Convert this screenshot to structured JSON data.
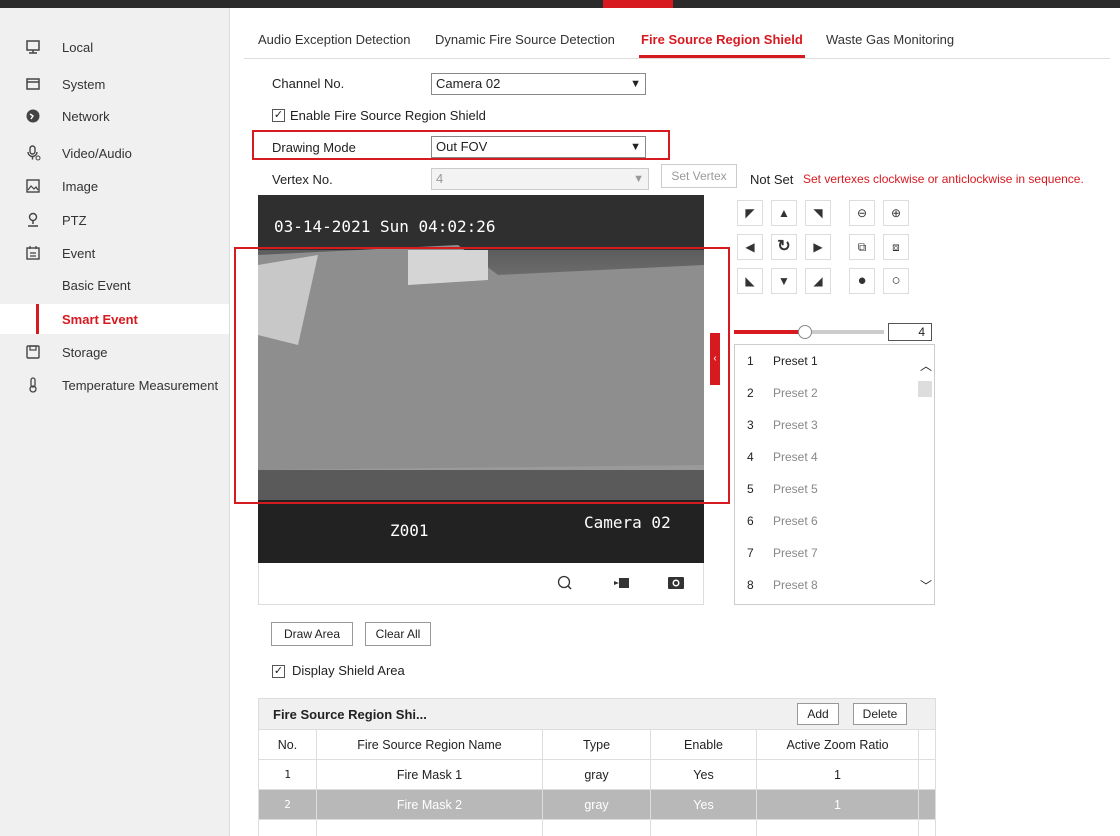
{
  "sidebar": {
    "items": [
      {
        "label": "Local",
        "icon": "monitor-icon"
      },
      {
        "label": "System",
        "icon": "system-icon"
      },
      {
        "label": "Network",
        "icon": "network-icon"
      },
      {
        "label": "Video/Audio",
        "icon": "mic-icon"
      },
      {
        "label": "Image",
        "icon": "image-icon"
      },
      {
        "label": "PTZ",
        "icon": "ptz-icon"
      },
      {
        "label": "Event",
        "icon": "calendar-icon"
      },
      {
        "label": "Basic Event"
      },
      {
        "label": "Smart Event"
      },
      {
        "label": "Storage",
        "icon": "storage-icon"
      },
      {
        "label": "Temperature Measurement",
        "icon": "thermometer-icon"
      }
    ]
  },
  "tabs": [
    "Audio Exception Detection",
    "Dynamic Fire Source Detection",
    "Fire Source Region Shield",
    "Waste Gas Monitoring"
  ],
  "form": {
    "channel_label": "Channel No.",
    "channel_value": "Camera 02",
    "enable_label": "Enable Fire Source Region Shield",
    "drawing_mode_label": "Drawing Mode",
    "drawing_mode_value": "Out FOV",
    "vertex_label": "Vertex No.",
    "vertex_value": "4",
    "set_vertex": "Set Vertex",
    "not_set": "Not Set",
    "hint": "Set vertexes clockwise or anticlockwise in sequence."
  },
  "video": {
    "timestamp": "03-14-2021 Sun 04:02:26",
    "left_label": "Z001",
    "camera_label": "Camera 02"
  },
  "ptz": {
    "speed": "4"
  },
  "presets": [
    {
      "num": "1",
      "name": "Preset 1"
    },
    {
      "num": "2",
      "name": "Preset 2"
    },
    {
      "num": "3",
      "name": "Preset 3"
    },
    {
      "num": "4",
      "name": "Preset 4"
    },
    {
      "num": "5",
      "name": "Preset 5"
    },
    {
      "num": "6",
      "name": "Preset 6"
    },
    {
      "num": "7",
      "name": "Preset 7"
    },
    {
      "num": "8",
      "name": "Preset 8"
    }
  ],
  "actions": {
    "draw_area": "Draw Area",
    "clear_all": "Clear All",
    "display_shield": "Display Shield Area"
  },
  "table": {
    "title": "Fire Source Region Shi...",
    "add": "Add",
    "delete": "Delete",
    "headers": [
      "No.",
      "Fire Source Region Name",
      "Type",
      "Enable",
      "Active Zoom Ratio"
    ],
    "rows": [
      [
        "1",
        "Fire Mask 1",
        "gray",
        "Yes",
        "1"
      ],
      [
        "2",
        "Fire Mask 2",
        "gray",
        "Yes",
        "1"
      ]
    ]
  },
  "colors": {
    "accent": "#d71920"
  }
}
